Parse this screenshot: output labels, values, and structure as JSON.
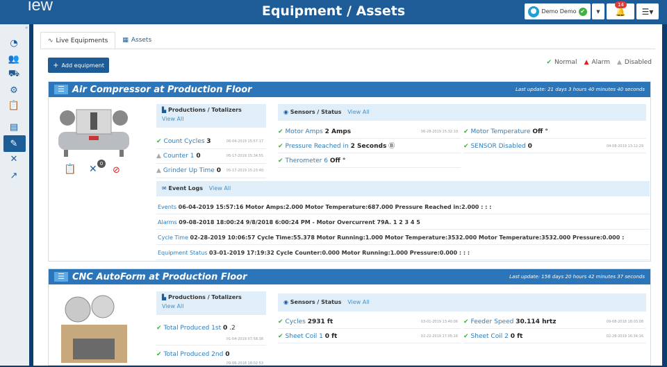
{
  "header": {
    "logo": "iew",
    "title": "Equipment / Assets",
    "user": "Demo Demo",
    "notif_count": "14"
  },
  "sidebar": {
    "icons": [
      "gauge-icon",
      "users-icon",
      "truck-icon",
      "cogs-icon",
      "clipboard-icon",
      "report-icon",
      "wrench-icon",
      "tools-icon",
      "chart-line-icon"
    ]
  },
  "tabs": [
    {
      "label": "Live Equipments"
    },
    {
      "label": "Assets"
    }
  ],
  "add_button": "Add equipment",
  "legend": {
    "normal": "Normal",
    "alarm": "Alarm",
    "disabled": "Disabled"
  },
  "cards": [
    {
      "title": "Air Compressor at Production Floor",
      "last_update": "Last update: 21 days 3 hours 40 minutes 40 seconds",
      "counter_badge": "0",
      "productions_head": "Productions / Totalizers",
      "view_all": "View All",
      "productions": [
        {
          "label": "Count Cycles",
          "value": "3",
          "ts": "06-04-2019 15:57:17"
        },
        {
          "label": "Counter 1",
          "value": "0",
          "ts": "05-17-2019 15:34:55"
        },
        {
          "label": "Grinder Up Time",
          "value": "0",
          "ts": "05-17-2019 15:23:40"
        }
      ],
      "sensors_head": "Sensors / Status",
      "sensors": [
        {
          "label": "Motor Amps",
          "value": "2 Amps",
          "ts": "06-28-2019 15:32:10"
        },
        {
          "label": "Motor Temperature",
          "value": "Off °",
          "ts": ""
        },
        {
          "label": "Pressure Reached in",
          "value": "2 Seconds",
          "ts": ""
        },
        {
          "label": "SENSOR Disabled",
          "value": "0",
          "ts": "04-08-2019 13:12:29"
        },
        {
          "label": "Therometer 6",
          "value": "Off °",
          "ts": ""
        }
      ],
      "events_head": "Event Logs",
      "events": [
        {
          "label": "Events",
          "value": "06-04-2019 15:57:16 Motor Amps:2.000 Motor Temperature:687.000 Pressure Reached in:2.000 : : :"
        },
        {
          "label": "Alarms",
          "value": "09-08-2018 18:00:24 9/8/2018 6:00:24 PM - Motor Overcurrent 79A. 1 2 3 4 5"
        },
        {
          "label": "Cycle Time",
          "value": "02-28-2019 10:06:57 Cycle Time:55.378 Motor Running:1.000 Motor Temperature:3532.000 Motor Temperature:3532.000 Pressure:0.000 :"
        },
        {
          "label": "Equipment Status",
          "value": "03-01-2019 17:19:32 Cycle Counter:0.000 Motor Running:1.000 Pressure:0.000 : : :"
        }
      ]
    },
    {
      "title": "CNC AutoForm at Production Floor",
      "last_update": "Last update: 156 days 20 hours 42 minutes 37 seconds",
      "productions_head": "Productions / Totalizers",
      "view_all": "View All",
      "productions": [
        {
          "label": "Total Produced 1st",
          "value": "0",
          "suffix": ".2",
          "ts": "01-04-2019 07:58:38"
        },
        {
          "label": "Total Produced 2nd",
          "value": "0",
          "ts": "09-06-2018 18:02:53"
        }
      ],
      "sensors_head": "Sensors / Status",
      "sensors": [
        {
          "label": "Cycles",
          "value": "2931 ft",
          "ts": "03-01-2019 13:40:06"
        },
        {
          "label": "Feeder Speed",
          "value": "30.114 hrtz",
          "ts": "09-08-2018 18:03:08"
        },
        {
          "label": "Sheet Coil 1",
          "value": "0 ft",
          "ts": "02-22-2019 17:05:16"
        },
        {
          "label": "Sheet Coil 2",
          "value": "0 ft",
          "ts": "02-28-2019 16:34:16"
        }
      ]
    }
  ]
}
